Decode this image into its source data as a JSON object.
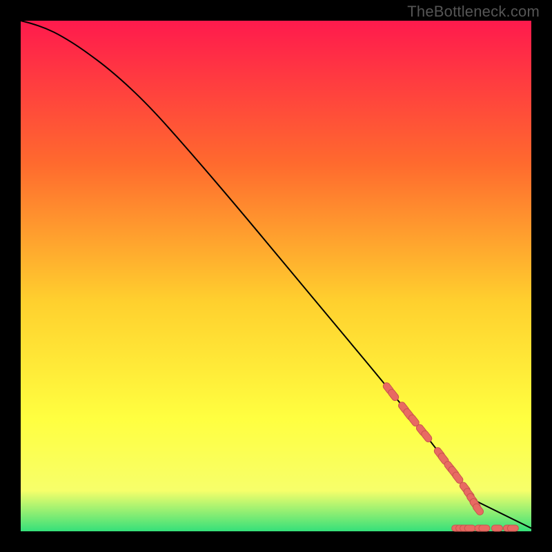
{
  "watermark": "TheBottleneck.com",
  "colors": {
    "bg": "#000000",
    "grad_top": "#ff1a4d",
    "grad_mid1": "#ff6a2e",
    "grad_mid2": "#ffd02e",
    "grad_mid3": "#ffff40",
    "grad_mid4": "#f7ff6a",
    "grad_bottom": "#35e07a",
    "curve": "#000000",
    "marker_fill": "#e86a62",
    "marker_stroke": "#c9544d"
  },
  "chart_data": {
    "type": "line",
    "title": "",
    "xlabel": "",
    "ylabel": "",
    "xlim": [
      0,
      100
    ],
    "ylim": [
      0,
      100
    ],
    "series": [
      {
        "name": "curve",
        "x": [
          0,
          2,
          5,
          8,
          12,
          18,
          25,
          33,
          42,
          52,
          62,
          72,
          80,
          86,
          88
        ],
        "values": [
          100,
          99.5,
          98.5,
          97,
          94.5,
          90,
          83.5,
          74.5,
          64,
          52,
          40,
          28,
          18,
          10,
          6.5
        ]
      }
    ],
    "markers_on_curve": [
      {
        "x": 72.0,
        "y": 28.0
      },
      {
        "x": 73.0,
        "y": 26.7
      },
      {
        "x": 75.0,
        "y": 24.2
      },
      {
        "x": 76.0,
        "y": 22.9
      },
      {
        "x": 77.0,
        "y": 21.7
      },
      {
        "x": 78.5,
        "y": 19.8
      },
      {
        "x": 79.5,
        "y": 18.6
      },
      {
        "x": 82.0,
        "y": 15.3
      },
      {
        "x": 82.8,
        "y": 14.2
      },
      {
        "x": 84.0,
        "y": 12.6
      },
      {
        "x": 84.8,
        "y": 11.6
      },
      {
        "x": 85.6,
        "y": 10.5
      },
      {
        "x": 87.0,
        "y": 8.5
      },
      {
        "x": 87.8,
        "y": 7.3
      },
      {
        "x": 88.4,
        "y": 6.3
      },
      {
        "x": 89.0,
        "y": 5.3
      },
      {
        "x": 89.6,
        "y": 4.3
      }
    ],
    "markers_on_axis": [
      {
        "x": 85.5,
        "y": 0.6
      },
      {
        "x": 86.3,
        "y": 0.6
      },
      {
        "x": 87.1,
        "y": 0.6
      },
      {
        "x": 88.0,
        "y": 0.6
      },
      {
        "x": 90.0,
        "y": 0.6
      },
      {
        "x": 90.8,
        "y": 0.6
      },
      {
        "x": 93.3,
        "y": 0.6
      },
      {
        "x": 95.6,
        "y": 0.6
      },
      {
        "x": 96.4,
        "y": 0.6
      }
    ],
    "tail_segment": {
      "x0": 88,
      "y0": 6.5,
      "x1": 100,
      "y1": 0.6
    }
  }
}
